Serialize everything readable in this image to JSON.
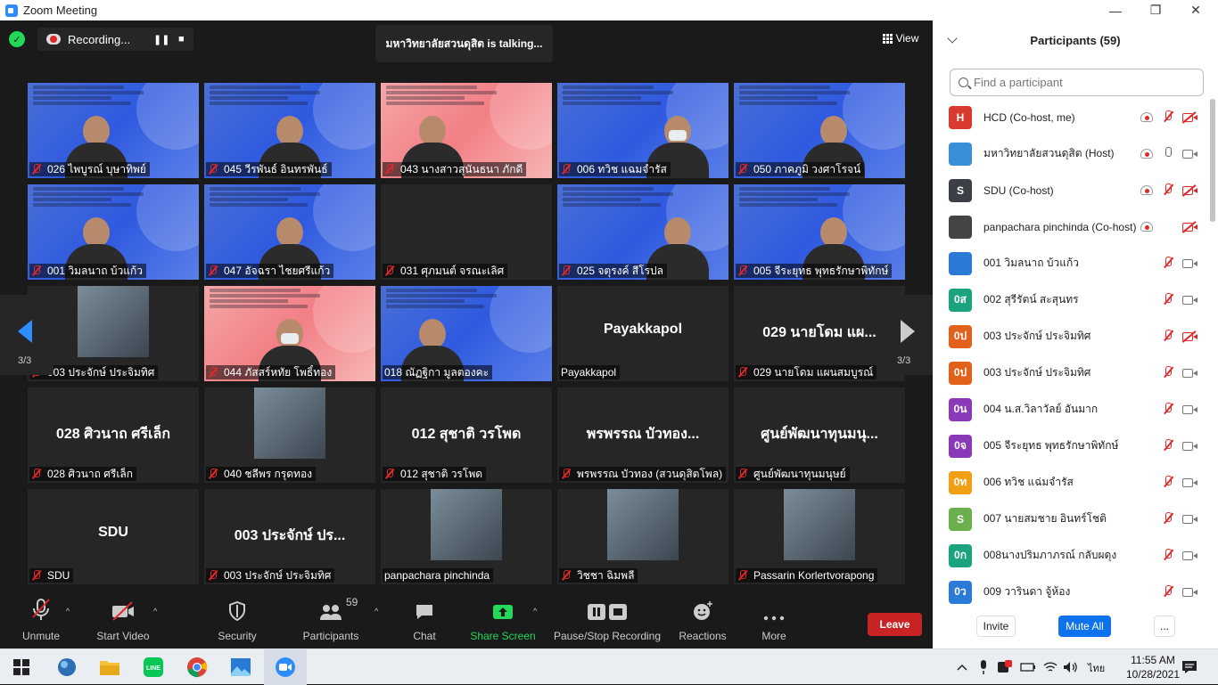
{
  "window": {
    "title": "Zoom Meeting"
  },
  "header": {
    "recording": "Recording...",
    "talking": "มหาวิทยาลัยสวนดุสิต  is  talking...",
    "view": "View"
  },
  "grid": {
    "page_left": "3/3",
    "page_right": "3/3",
    "tiles": [
      {
        "label": "026 ไพบูรณ์ บุษาทิพย์",
        "kind": "blue",
        "muted": true,
        "big": ""
      },
      {
        "label": "045 วีรพันธ์ อินทรพันธ์",
        "kind": "blue",
        "muted": true,
        "big": ""
      },
      {
        "label": "043 นางสาวสุนันธนา ภักดี",
        "kind": "pink",
        "muted": true,
        "big": ""
      },
      {
        "label": "006 ทวิช   แฉมจำรัส",
        "kind": "blue",
        "muted": true,
        "big": ""
      },
      {
        "label": "050 ภาคภูมิ วงศาโรจน์",
        "kind": "blue",
        "muted": true,
        "big": ""
      },
      {
        "label": "001 วิมลนาถ บ้วแก้ว",
        "kind": "blue",
        "muted": true,
        "big": ""
      },
      {
        "label": "047 อัจฉรา ไชยศรีแก้ว",
        "kind": "blue",
        "muted": true,
        "big": ""
      },
      {
        "label": "031 ศุภมนต์ จรณะเลิศ",
        "kind": "dark",
        "muted": true,
        "big": ""
      },
      {
        "label": "025 จตุรงค์ สีโรปล",
        "kind": "blue",
        "muted": true,
        "big": ""
      },
      {
        "label": "005 จีระยุทธ พุทธรักษาพิทักษ์",
        "kind": "blue",
        "muted": true,
        "big": ""
      },
      {
        "label": "003 ประจักษ์ ประจิมทิศ",
        "kind": "thumb",
        "muted": true,
        "big": ""
      },
      {
        "label": "044 ภัสสร์หทัย โพธิ์ทอง",
        "kind": "pink",
        "muted": true,
        "big": ""
      },
      {
        "label": "018 ณัฏฐิกา  มูลตองคะ",
        "kind": "blue",
        "muted": false,
        "big": ""
      },
      {
        "label": "Payakkapol",
        "kind": "dark",
        "muted": false,
        "big": "Payakkapol"
      },
      {
        "label": "029 นายโดม แผนสมบูรณ์",
        "kind": "dark",
        "muted": true,
        "big": "029 นายโดม แผ..."
      },
      {
        "label": "028 ศิวนาถ ศรีเล็ก",
        "kind": "dark",
        "muted": true,
        "big": "028 ศิวนาถ ศรีเล็ก"
      },
      {
        "label": "040 ชลีพร  กรุดทอง",
        "kind": "thumb",
        "muted": true,
        "big": ""
      },
      {
        "label": "012 สุชาติ วรโพด",
        "kind": "dark",
        "muted": true,
        "big": "012 สุชาติ วรโพด"
      },
      {
        "label": "พรพรรณ บัวทอง (สวนดุสิตโพล)",
        "kind": "dark",
        "muted": true,
        "big": "พรพรรณ บัวทอง..."
      },
      {
        "label": "ศูนย์พัฒนาทุนมนุษย์",
        "kind": "dark",
        "muted": true,
        "big": "ศูนย์พัฒนาทุนมนุ..."
      },
      {
        "label": "SDU",
        "kind": "dark",
        "muted": true,
        "big": "SDU"
      },
      {
        "label": "003 ประจักษ์  ประจิมทิศ",
        "kind": "dark",
        "muted": true,
        "big": "003 ประจักษ์  ปร..."
      },
      {
        "label": "panpachara pinchinda",
        "kind": "thumb",
        "muted": false,
        "big": ""
      },
      {
        "label": "วิชชา ฉิมพลี",
        "kind": "thumb",
        "muted": true,
        "big": ""
      },
      {
        "label": "Passarin Korlertvorapong",
        "kind": "thumb",
        "muted": true,
        "big": ""
      }
    ]
  },
  "toolbar": {
    "unmute": "Unmute",
    "start_video": "Start Video",
    "security": "Security",
    "participants": "Participants",
    "participants_count": "59",
    "chat": "Chat",
    "share": "Share Screen",
    "recording": "Pause/Stop Recording",
    "reactions": "Reactions",
    "more": "More",
    "leave": "Leave"
  },
  "panel": {
    "title": "Participants (59)",
    "search_placeholder": "Find a participant",
    "invite": "Invite",
    "mute_all": "Mute All",
    "more": "...",
    "participants": [
      {
        "initials": "H",
        "color": "#d93a2f",
        "name": "HCD (Co-host, me)",
        "rec": true,
        "mic": "off",
        "cam": "off"
      },
      {
        "initials": "",
        "color": "#3a8fd9",
        "name": "มหาวิทยาลัยสวนดุสิต (Host)",
        "rec": true,
        "mic": "on",
        "cam": "on"
      },
      {
        "initials": "S",
        "color": "#3c4046",
        "name": "SDU (Co-host)",
        "rec": true,
        "mic": "off",
        "cam": "off"
      },
      {
        "initials": "",
        "color": "#444",
        "name": "panpachara pinchinda (Co-host)",
        "rec": true,
        "mic": "none",
        "cam": "off"
      },
      {
        "initials": "",
        "color": "#2b7bd6",
        "name": "001 วิมลนาถ บ้วแก้ว",
        "rec": false,
        "mic": "off",
        "cam": "on"
      },
      {
        "initials": "0ส",
        "color": "#1ba37f",
        "name": "002 สุรีรัตน์  สะสุนทร",
        "rec": false,
        "mic": "off",
        "cam": "on"
      },
      {
        "initials": "0ป",
        "color": "#e2621b",
        "name": "003 ประจักษ์  ประจิมทิศ",
        "rec": false,
        "mic": "off",
        "cam": "off"
      },
      {
        "initials": "0ป",
        "color": "#e2621b",
        "name": "003 ประจักษ์ ประจิมทิศ",
        "rec": false,
        "mic": "off",
        "cam": "on"
      },
      {
        "initials": "0น",
        "color": "#8a3ab9",
        "name": "004 น.ส.วิลาวัลย์ อันมาก",
        "rec": false,
        "mic": "off",
        "cam": "on"
      },
      {
        "initials": "0จ",
        "color": "#8a3ab9",
        "name": "005 จีระยุทธ พุทธรักษาพิทักษ์",
        "rec": false,
        "mic": "off",
        "cam": "on"
      },
      {
        "initials": "0ท",
        "color": "#f0a012",
        "name": "006 ทวิช  แฉ่มจำรัส",
        "rec": false,
        "mic": "off",
        "cam": "on"
      },
      {
        "initials": "S",
        "color": "#6ab04c",
        "name": "007 นายสมชาย อินทร์โชติ",
        "rec": false,
        "mic": "off",
        "cam": "on"
      },
      {
        "initials": "0ก",
        "color": "#1ba37f",
        "name": "008นางปริมภาภรณ์ กลับผดุง",
        "rec": false,
        "mic": "off",
        "cam": "on"
      },
      {
        "initials": "0ว",
        "color": "#2b7bd6",
        "name": "009 วารินดา  จู้ห้อง",
        "rec": false,
        "mic": "off",
        "cam": "on"
      }
    ]
  },
  "taskbar": {
    "time": "11:55 AM",
    "date": "10/28/2021",
    "lang": "ไทย"
  }
}
